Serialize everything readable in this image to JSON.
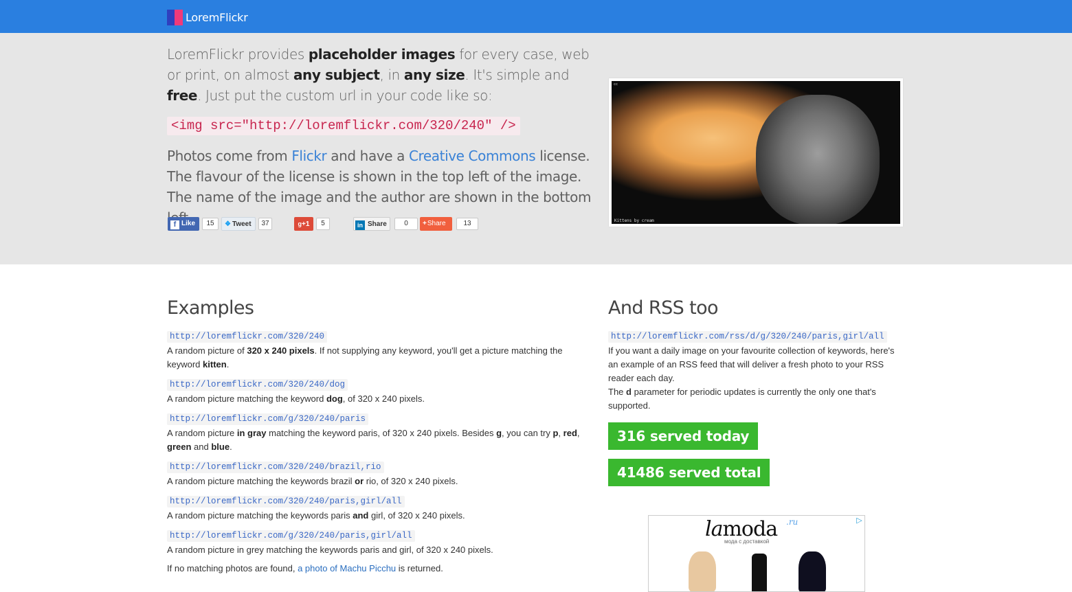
{
  "navbar": {
    "brand": "LoremFlickr"
  },
  "hero": {
    "p1": [
      {
        "t": "LoremFlickr provides ",
        "b": false
      },
      {
        "t": "placeholder images",
        "b": true
      },
      {
        "t": " for every case, web or print, on almost ",
        "b": false
      },
      {
        "t": "any subject",
        "b": true
      },
      {
        "t": ", in ",
        "b": false
      },
      {
        "t": "any size",
        "b": true
      },
      {
        "t": ". It's simple and ",
        "b": false
      },
      {
        "t": "free",
        "b": true
      },
      {
        "t": ". Just put the custom url in your code like so:",
        "b": false
      }
    ],
    "code": "<img src=\"http://loremflickr.com/320/240\" />",
    "p2_a": "Photos come from ",
    "p2_link1": "Flickr",
    "p2_b": " and have a ",
    "p2_link2": "Creative Commons",
    "p2_c": " license. The flavour of the license is shown in the top left of the image. The name of the image and the author are shown in the bottom left.",
    "image_caption": "Kittens by cream"
  },
  "social": {
    "like_label": "Like",
    "like_count": "15",
    "tweet_label": "Tweet",
    "tweet_count": "37",
    "gplus_label": "+1",
    "gplus_count": "5",
    "linkedin_label": "Share",
    "linkedin_count": "0",
    "share_label": "Share",
    "share_count": "13"
  },
  "examples": {
    "title": "Examples",
    "items": [
      {
        "url": "http://loremflickr.com/320/240",
        "desc": [
          {
            "t": "A random picture of ",
            "b": false
          },
          {
            "t": "320 x 240 pixels",
            "b": true
          },
          {
            "t": ". If not supplying any keyword, you'll get a picture matching the keyword ",
            "b": false
          },
          {
            "t": "kitten",
            "b": true
          },
          {
            "t": ".",
            "b": false
          }
        ]
      },
      {
        "url": "http://loremflickr.com/320/240/dog",
        "desc": [
          {
            "t": "A random picture matching the keyword ",
            "b": false
          },
          {
            "t": "dog",
            "b": true
          },
          {
            "t": ", of 320 x 240 pixels.",
            "b": false
          }
        ]
      },
      {
        "url": "http://loremflickr.com/g/320/240/paris",
        "desc": [
          {
            "t": "A random picture ",
            "b": false
          },
          {
            "t": "in gray",
            "b": true
          },
          {
            "t": " matching the keyword paris, of 320 x 240 pixels. Besides ",
            "b": false
          },
          {
            "t": "g",
            "b": true
          },
          {
            "t": ", you can try ",
            "b": false
          },
          {
            "t": "p",
            "b": true
          },
          {
            "t": ", ",
            "b": false
          },
          {
            "t": "red",
            "b": true
          },
          {
            "t": ", ",
            "b": false
          },
          {
            "t": "green",
            "b": true
          },
          {
            "t": " and ",
            "b": false
          },
          {
            "t": "blue",
            "b": true
          },
          {
            "t": ".",
            "b": false
          }
        ]
      },
      {
        "url": "http://loremflickr.com/320/240/brazil,rio",
        "desc": [
          {
            "t": "A random picture matching the keywords brazil ",
            "b": false
          },
          {
            "t": "or",
            "b": true
          },
          {
            "t": " rio, of 320 x 240 pixels.",
            "b": false
          }
        ]
      },
      {
        "url": "http://loremflickr.com/320/240/paris,girl/all",
        "desc": [
          {
            "t": "A random picture matching the keywords paris ",
            "b": false
          },
          {
            "t": "and",
            "b": true
          },
          {
            "t": " girl, of 320 x 240 pixels.",
            "b": false
          }
        ]
      },
      {
        "url": "http://loremflickr.com/g/320/240/paris,girl/all",
        "desc": [
          {
            "t": "A random picture in grey matching the keywords paris and girl, of 320 x 240 pixels.",
            "b": false
          }
        ]
      }
    ],
    "footer_a": "If no matching photos are found, ",
    "footer_link": "a photo of Machu Picchu",
    "footer_b": " is returned."
  },
  "rss": {
    "title": "And RSS too",
    "url": "http://loremflickr.com/rss/d/g/320/240/paris,girl/all",
    "p1": "If you want a daily image on your favourite collection of keywords, here's an example of an RSS feed that will deliver a fresh photo to your RSS reader each day.",
    "p2_a": "The ",
    "p2_b": "d",
    "p2_c": " parameter for periodic updates is currently the only one that's supported."
  },
  "stats": {
    "today": "316 served today",
    "total": "41486 served total"
  },
  "ad": {
    "brand_a": "la",
    "brand_b": "moda",
    "brand_ru": ".ru",
    "tagline": "мода с доставкой"
  },
  "colors": {
    "navbar": "#2a7fe0",
    "hero_bg": "#e6e6e6",
    "stat_green": "#3ab82f",
    "link": "#3a82d6",
    "code_red": "#c7254e"
  }
}
